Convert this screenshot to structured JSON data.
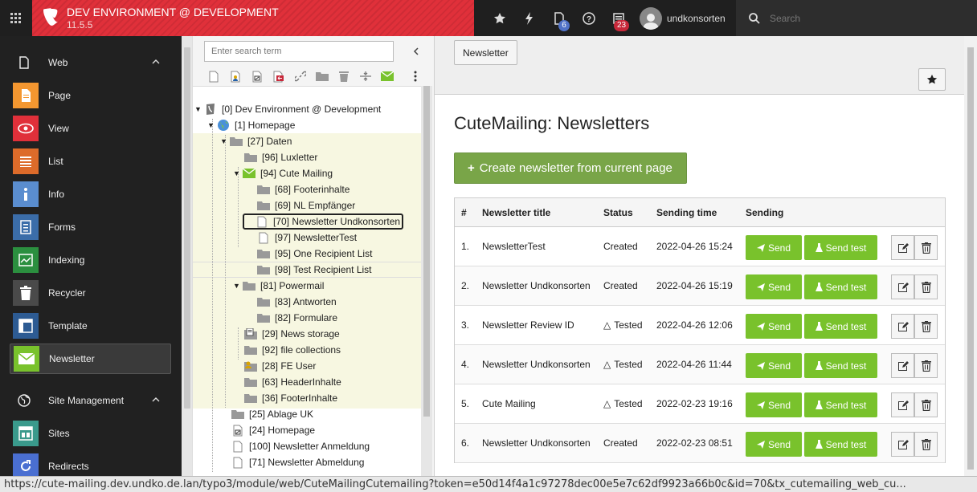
{
  "topbar": {
    "env_title": "DEV ENVIRONMENT @ DEVELOPMENT",
    "version": "11.5.5",
    "opendocs_badge": "6",
    "systeminfo_badge": "23",
    "username": "undkonsorten",
    "search_placeholder": "Search",
    "brand_color": "#e0303a"
  },
  "modules": {
    "web_group": "Web",
    "site_group": "Site Management",
    "items": [
      {
        "label": "Page",
        "color": "#f49730"
      },
      {
        "label": "View",
        "color": "#e0303a"
      },
      {
        "label": "List",
        "color": "#dd6b2a"
      },
      {
        "label": "Info",
        "color": "#5a8dcf"
      },
      {
        "label": "Forms",
        "color": "#3b6da9"
      },
      {
        "label": "Indexing",
        "color": "#2b8f3f"
      },
      {
        "label": "Recycler",
        "color": "#4a4a4a"
      },
      {
        "label": "Template",
        "color": "#2d5b93"
      },
      {
        "label": "Newsletter",
        "color": "#79c22c"
      }
    ],
    "site_items": [
      {
        "label": "Sites",
        "color": "#3a9a8c"
      },
      {
        "label": "Redirects",
        "color": "#4a6fd1"
      }
    ]
  },
  "tree": {
    "search_placeholder": "Enter search term",
    "nodes": [
      {
        "label": "[0] Dev Environment @ Development"
      },
      {
        "label": "[1] Homepage"
      },
      {
        "label": "[27] Daten"
      },
      {
        "label": "[96] Luxletter"
      },
      {
        "label": "[94] Cute Mailing"
      },
      {
        "label": "[68] Footerinhalte"
      },
      {
        "label": "[69] NL Empfänger"
      },
      {
        "label": "[70] Newsletter Undkonsorten"
      },
      {
        "label": "[97] NewsletterTest"
      },
      {
        "label": "[95] One Recipient List"
      },
      {
        "label": "[98] Test Recipient List"
      },
      {
        "label": "[81] Powermail"
      },
      {
        "label": "[83] Antworten"
      },
      {
        "label": "[82] Formulare"
      },
      {
        "label": "[29] News storage"
      },
      {
        "label": "[92] file collections"
      },
      {
        "label": "[28] FE User"
      },
      {
        "label": "[63] HeaderInhalte"
      },
      {
        "label": "[36] FooterInhalte"
      },
      {
        "label": "[25] Ablage UK"
      },
      {
        "label": "[24] Homepage"
      },
      {
        "label": "[100] Newsletter Anmeldung"
      },
      {
        "label": "[71] Newsletter Abmeldung"
      }
    ]
  },
  "content": {
    "breadcrumb_button": "Newsletter",
    "title": "CuteMailing: Newsletters",
    "create_button": "Create newsletter from current page",
    "table": {
      "headers": [
        "#",
        "Newsletter title",
        "Status",
        "Sending time",
        "Sending"
      ],
      "send_label": "Send",
      "send_test_label": "Send test",
      "rows": [
        {
          "num": "1.",
          "title": "NewsletterTest",
          "status": "Created",
          "tested": false,
          "time": "2022-04-26 15:24"
        },
        {
          "num": "2.",
          "title": "Newsletter Undkonsorten",
          "status": "Created",
          "tested": false,
          "time": "2022-04-26 15:19"
        },
        {
          "num": "3.",
          "title": "Newsletter Review ID",
          "status": "Tested",
          "tested": true,
          "time": "2022-04-26 12:06"
        },
        {
          "num": "4.",
          "title": "Newsletter Undkonsorten",
          "status": "Tested",
          "tested": true,
          "time": "2022-04-26 11:44"
        },
        {
          "num": "5.",
          "title": "Cute Mailing",
          "status": "Tested",
          "tested": true,
          "time": "2022-02-23 19:16"
        },
        {
          "num": "6.",
          "title": "Newsletter Undkonsorten",
          "status": "Created",
          "tested": false,
          "time": "2022-02-23 08:51"
        }
      ]
    }
  },
  "statusbar": {
    "url": "https://cute-mailing.dev.undko.de.lan/typo3/module/web/CuteMailingCutemailing?token=e50d14f4a1c97278dec00e5e7c62df9923a66b0c&id=70&tx_cutemailing_web_cu..."
  }
}
